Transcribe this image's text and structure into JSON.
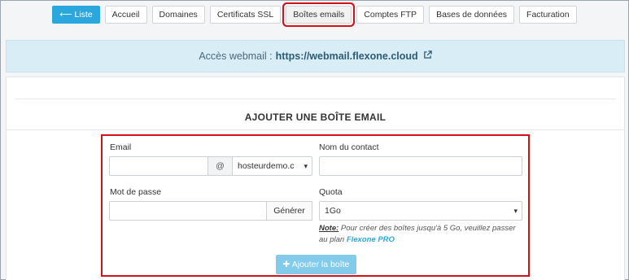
{
  "tabs": [
    {
      "label": "Liste",
      "icon": "arrow-left-icon"
    },
    {
      "label": "Accueil"
    },
    {
      "label": "Domaines"
    },
    {
      "label": "Certificats SSL"
    },
    {
      "label": "Boîtes emails"
    },
    {
      "label": "Comptes FTP"
    },
    {
      "label": "Bases de données"
    },
    {
      "label": "Facturation"
    }
  ],
  "banner": {
    "prefix": "Accès webmail :",
    "url": "https://webmail.flexone.cloud",
    "icon": "external-link-icon"
  },
  "section_title": "AJOUTER UNE BOÎTE EMAIL",
  "form": {
    "email_label": "Email",
    "email_value": "",
    "at_symbol": "@",
    "domain_value": "hosteurdemo.c",
    "contact_label": "Nom du contact",
    "contact_value": "",
    "password_label": "Mot de passe",
    "password_value": "",
    "generate_label": "Générer",
    "quota_label": "Quota",
    "quota_value": "1Go",
    "note_prefix": "Note:",
    "note_text": " Pour créer des boîtes jusqu'à 5 Go, veuillez passer au plan ",
    "note_brand": "Flexone PRO",
    "submit_label": "Ajouter la boîte"
  },
  "colors": {
    "primary": "#2aa8de",
    "highlight": "#d0121b",
    "banner_bg": "#d9edf7"
  }
}
